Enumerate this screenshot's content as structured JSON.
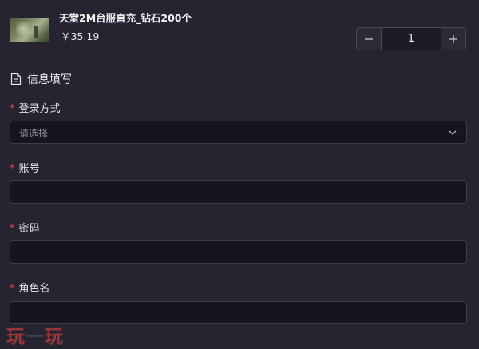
{
  "product": {
    "title": "天堂2M台服直充_钻石200个",
    "price": "￥35.19",
    "quantity": "1"
  },
  "section": {
    "title": "信息填写"
  },
  "fields": {
    "login_method": {
      "label": "登录方式",
      "placeholder": "请选择"
    },
    "account": {
      "label": "账号",
      "value": ""
    },
    "password": {
      "label": "密码",
      "value": ""
    },
    "character": {
      "label": "角色名",
      "value": ""
    }
  },
  "required_marker": "*",
  "colors": {
    "background": "#262430",
    "input_background": "#16151e",
    "required": "#d84a55"
  },
  "watermark": {
    "text_a": "玩",
    "text_b": "一",
    "text_c": "玩"
  }
}
